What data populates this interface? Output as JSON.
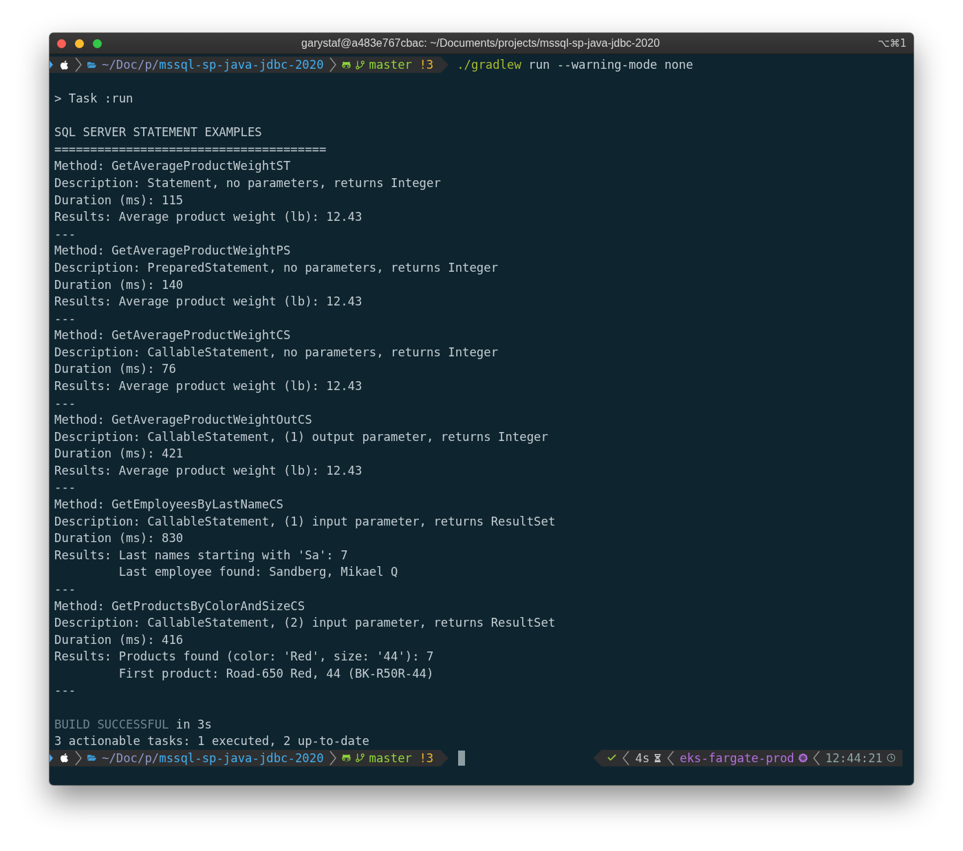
{
  "window": {
    "title": "garystaf@a483e767cbac: ~/Documents/projects/mssql-sp-java-jdbc-2020",
    "shortcut": "⌥⌘1"
  },
  "terminal": {
    "lines": [
      {
        "kind": "prompt",
        "path_dim": "~/Doc/p/",
        "path_name": "mssql-sp-java-jdbc-2020",
        "branch": "master",
        "git_status": "!3",
        "program": "./gradlew",
        "args": "run --warning-mode none"
      },
      {
        "kind": "blank"
      },
      {
        "kind": "text",
        "text": "> Task :run"
      },
      {
        "kind": "blank"
      },
      {
        "kind": "text",
        "text": "SQL SERVER STATEMENT EXAMPLES"
      },
      {
        "kind": "text",
        "text": "======================================"
      },
      {
        "kind": "text",
        "text": "Method: GetAverageProductWeightST"
      },
      {
        "kind": "text",
        "text": "Description: Statement, no parameters, returns Integer"
      },
      {
        "kind": "text",
        "text": "Duration (ms): 115"
      },
      {
        "kind": "text",
        "text": "Results: Average product weight (lb): 12.43"
      },
      {
        "kind": "text",
        "text": "---"
      },
      {
        "kind": "text",
        "text": "Method: GetAverageProductWeightPS"
      },
      {
        "kind": "text",
        "text": "Description: PreparedStatement, no parameters, returns Integer"
      },
      {
        "kind": "text",
        "text": "Duration (ms): 140"
      },
      {
        "kind": "text",
        "text": "Results: Average product weight (lb): 12.43"
      },
      {
        "kind": "text",
        "text": "---"
      },
      {
        "kind": "text",
        "text": "Method: GetAverageProductWeightCS"
      },
      {
        "kind": "text",
        "text": "Description: CallableStatement, no parameters, returns Integer"
      },
      {
        "kind": "text",
        "text": "Duration (ms): 76"
      },
      {
        "kind": "text",
        "text": "Results: Average product weight (lb): 12.43"
      },
      {
        "kind": "text",
        "text": "---"
      },
      {
        "kind": "text",
        "text": "Method: GetAverageProductWeightOutCS"
      },
      {
        "kind": "text",
        "text": "Description: CallableStatement, (1) output parameter, returns Integer"
      },
      {
        "kind": "text",
        "text": "Duration (ms): 421"
      },
      {
        "kind": "text",
        "text": "Results: Average product weight (lb): 12.43"
      },
      {
        "kind": "text",
        "text": "---"
      },
      {
        "kind": "text",
        "text": "Method: GetEmployeesByLastNameCS"
      },
      {
        "kind": "text",
        "text": "Description: CallableStatement, (1) input parameter, returns ResultSet"
      },
      {
        "kind": "text",
        "text": "Duration (ms): 830"
      },
      {
        "kind": "text",
        "text": "Results: Last names starting with 'Sa': 7"
      },
      {
        "kind": "text",
        "text": "         Last employee found: Sandberg, Mikael Q"
      },
      {
        "kind": "text",
        "text": "---"
      },
      {
        "kind": "text",
        "text": "Method: GetProductsByColorAndSizeCS"
      },
      {
        "kind": "text",
        "text": "Description: CallableStatement, (2) input parameter, returns ResultSet"
      },
      {
        "kind": "text",
        "text": "Duration (ms): 416"
      },
      {
        "kind": "text",
        "text": "Results: Products found (color: 'Red', size: '44'): 7"
      },
      {
        "kind": "text",
        "text": "         First product: Road-650 Red, 44 (BK-R50R-44)"
      },
      {
        "kind": "text",
        "text": "---"
      },
      {
        "kind": "blank"
      },
      {
        "kind": "status",
        "label": "BUILD SUCCESSFUL",
        "text": " in 3s"
      },
      {
        "kind": "text",
        "text": "3 actionable tasks: 1 executed, 2 up-to-date"
      },
      {
        "kind": "prompt",
        "path_dim": "~/Doc/p/",
        "path_name": "mssql-sp-java-jdbc-2020",
        "branch": "master",
        "git_status": "!3",
        "cursor": true,
        "right": {
          "exit_ok": true,
          "duration": "4s",
          "context": "eks-fargate-prod",
          "time": "12:44:21"
        }
      }
    ]
  }
}
